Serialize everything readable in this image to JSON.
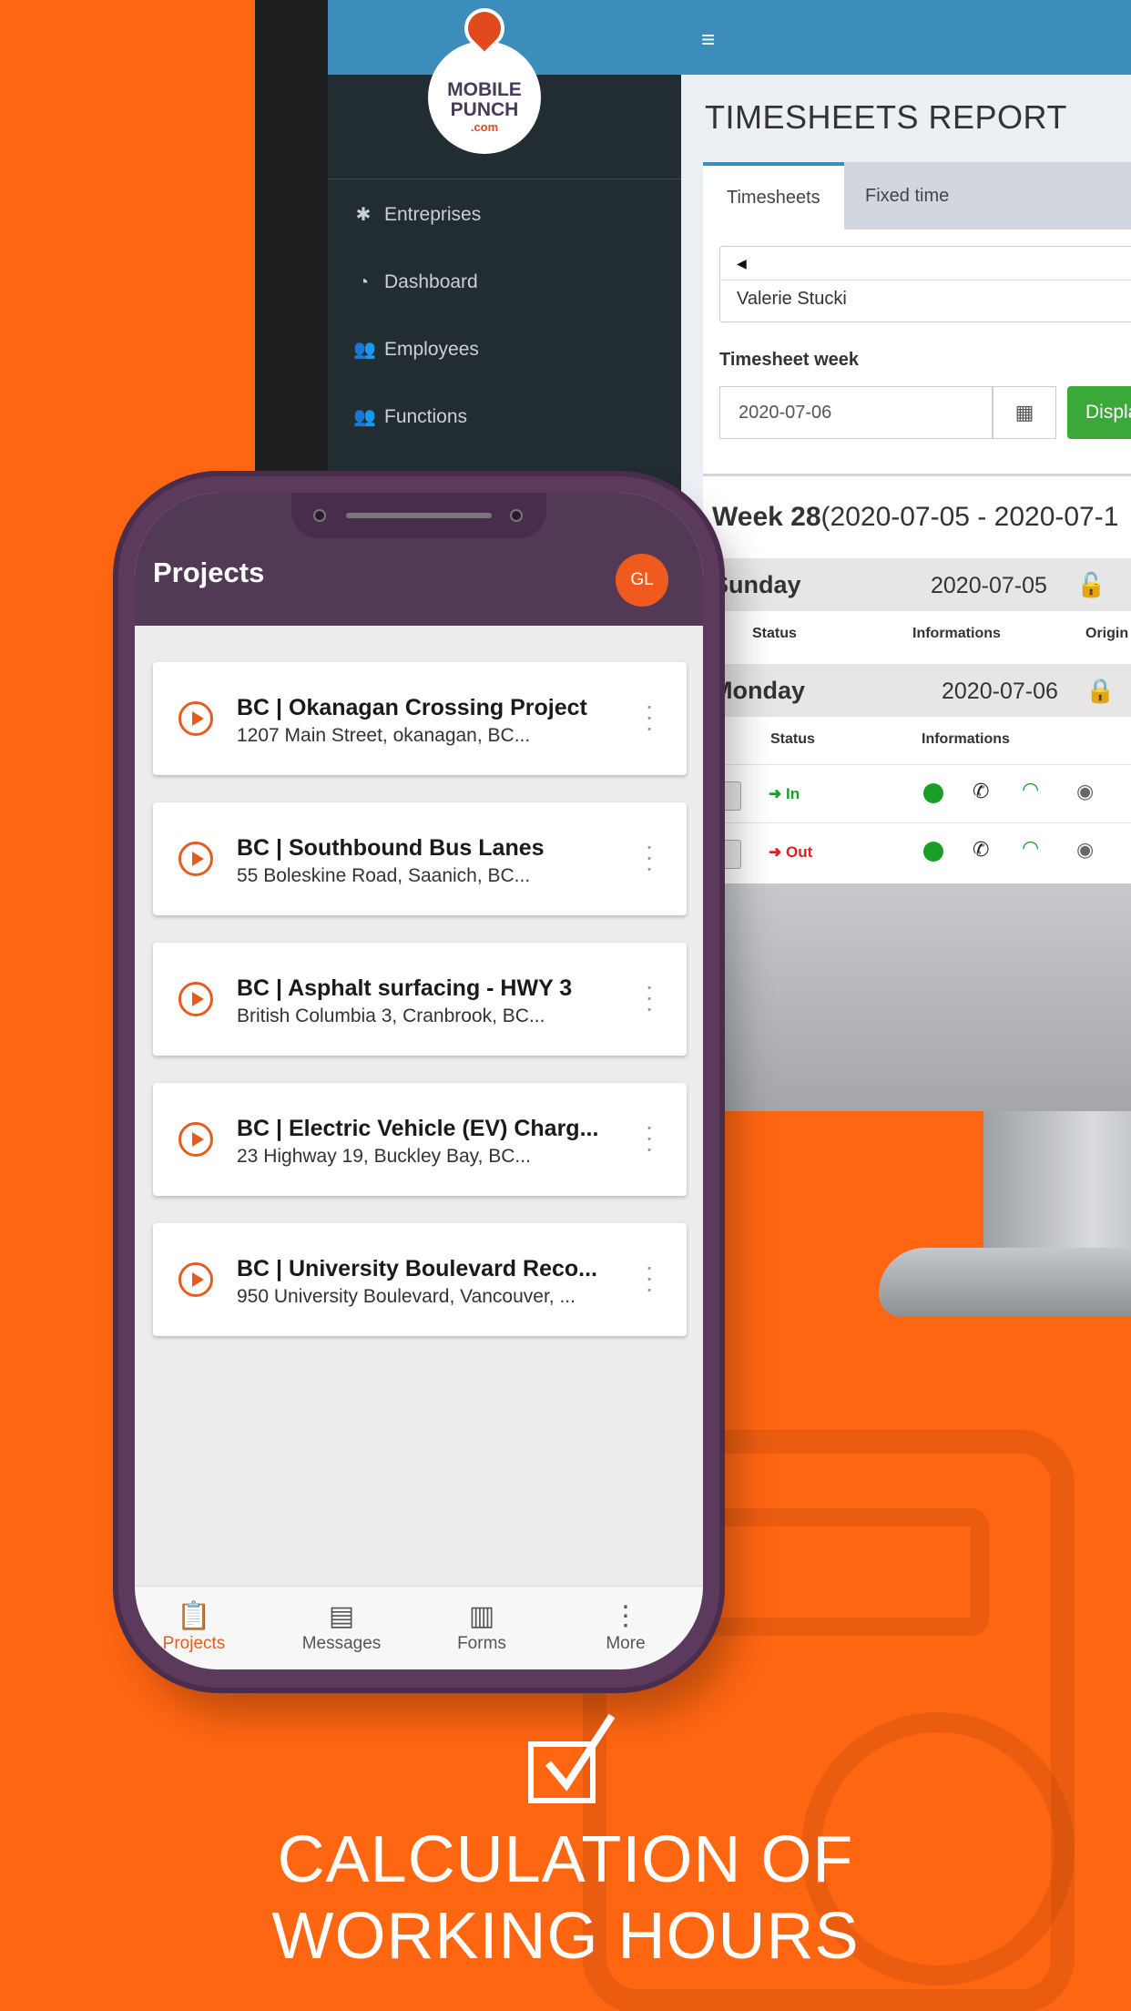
{
  "brand": {
    "line1": "MOBILE",
    "line2": "PUNCH",
    "line3": ".com"
  },
  "web": {
    "sidebar_items": [
      {
        "label": "Entreprises",
        "icon": "gear-icon"
      },
      {
        "label": "Dashboard",
        "icon": "dashboard-icon"
      },
      {
        "label": "Employees",
        "icon": "users-icon"
      },
      {
        "label": "Functions",
        "icon": "users-icon"
      }
    ],
    "page_title": "TIMESHEETS REPORT",
    "tabs": [
      "Timesheets",
      "Fixed time"
    ],
    "employee_select": "Valerie Stucki",
    "timesheet_week_label": "Timesheet week",
    "timesheet_week_value": "2020-07-06",
    "display_button": "Displa",
    "week_title_bold": "Week 28",
    "week_title_range": "(2020-07-05 - 2020-07-1",
    "days": [
      {
        "name": "Sunday",
        "date": "2020-07-05",
        "locked": false
      },
      {
        "name": "Monday",
        "date": "2020-07-06",
        "locked": true
      }
    ],
    "col_status": "Status",
    "col_informations": "Informations",
    "col_origin": "Origin",
    "punches": [
      {
        "label": "In",
        "color": "#1a9e2a"
      },
      {
        "label": "Out",
        "color": "#e02020"
      }
    ]
  },
  "app": {
    "title": "Projects",
    "avatar_initials": "GL",
    "projects": [
      {
        "title": "BC | Okanagan Crossing Project",
        "address": "1207 Main Street, okanagan, BC..."
      },
      {
        "title": "BC | Southbound Bus Lanes",
        "address": "55 Boleskine Road, Saanich, BC..."
      },
      {
        "title": "BC | Asphalt surfacing - HWY 3",
        "address": "British Columbia 3, Cranbrook, BC..."
      },
      {
        "title": "BC | Electric Vehicle (EV) Charg...",
        "address": "23 Highway 19, Buckley Bay, BC..."
      },
      {
        "title": "BC | University Boulevard Reco...",
        "address": "950 University Boulevard, Vancouver, ..."
      }
    ],
    "nav": [
      {
        "label": "Projects",
        "icon": "clipboard-icon"
      },
      {
        "label": "Messages",
        "icon": "message-icon"
      },
      {
        "label": "Forms",
        "icon": "document-icon"
      },
      {
        "label": "More",
        "icon": "more-vertical-icon"
      }
    ]
  },
  "headline": {
    "line1": "CALCULATION OF",
    "line2": "WORKING HOURS"
  },
  "colors": {
    "background": "#ff6611",
    "accent": "#e65c1e",
    "app_bar": "#523a57",
    "admin_blue": "#3c8dbc"
  }
}
